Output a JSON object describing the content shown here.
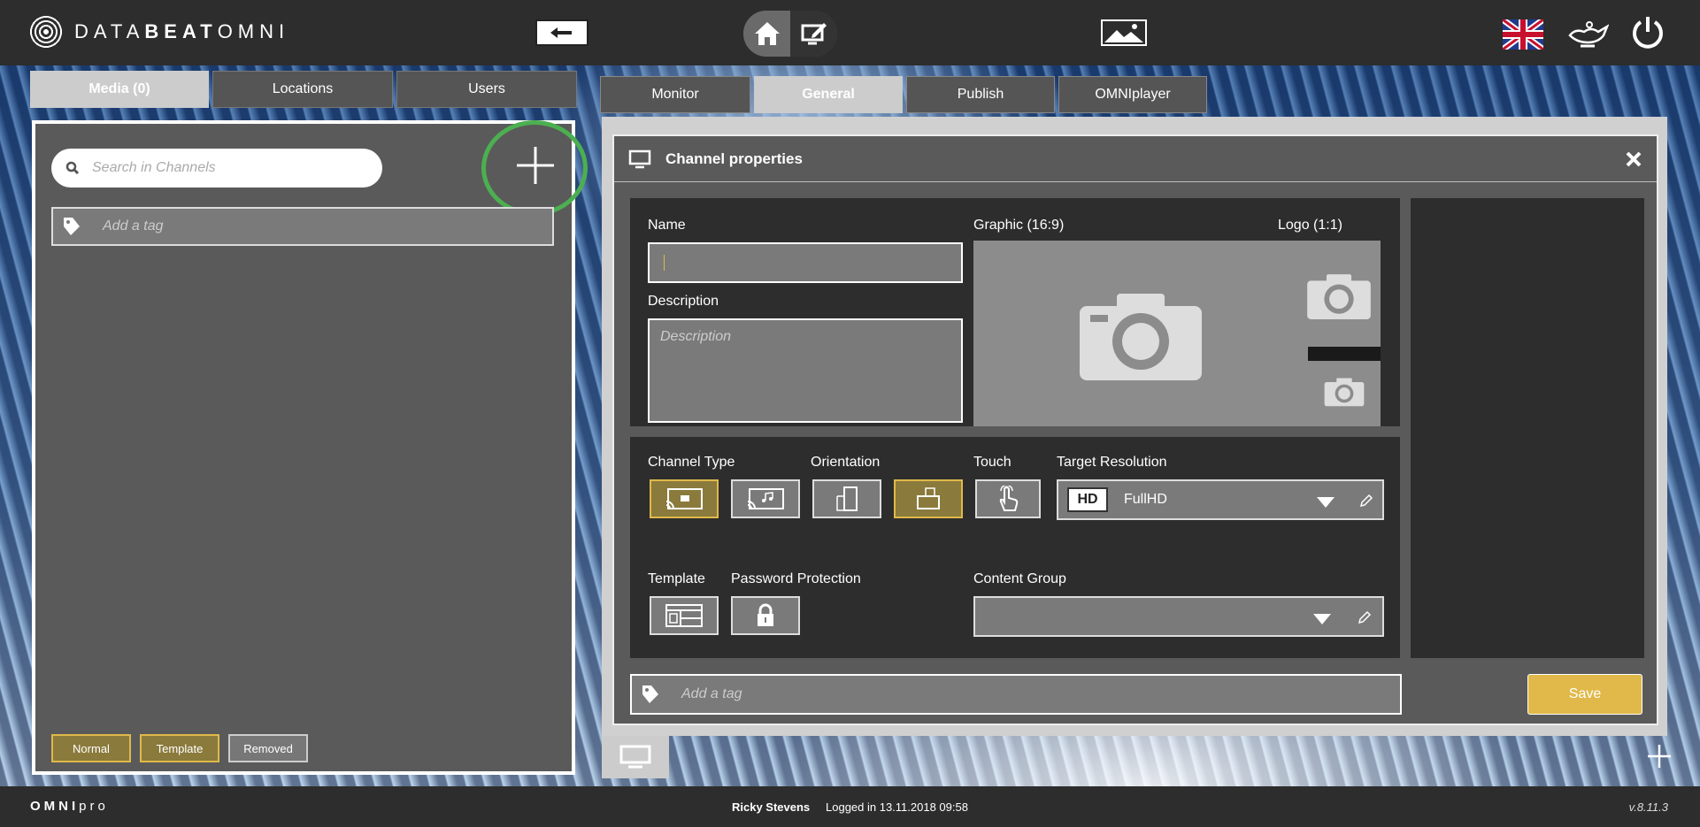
{
  "app": {
    "logo_text_a": "DATA",
    "logo_text_b": "BEAT",
    "logo_text_c": "OMNI"
  },
  "left_tabs": [
    {
      "label": "Media (0)"
    },
    {
      "label": "Locations"
    },
    {
      "label": "Users"
    }
  ],
  "channels": {
    "search_placeholder": "Search in Channels",
    "tag_placeholder": "Add a tag",
    "filters": [
      {
        "label": "Normal",
        "selected": true
      },
      {
        "label": "Template",
        "selected": true
      },
      {
        "label": "Removed",
        "selected": false
      }
    ]
  },
  "right_tabs": [
    {
      "label": "Monitor"
    },
    {
      "label": "General"
    },
    {
      "label": "Publish"
    },
    {
      "label": "OMNIplayer"
    }
  ],
  "dialog": {
    "title": "Channel properties",
    "name_label": "Name",
    "name_value": "",
    "description_label": "Description",
    "description_placeholder": "Description",
    "graphic_label": "Graphic (16:9)",
    "logo_label": "Logo (1:1)",
    "channel_type_label": "Channel Type",
    "orientation_label": "Orientation",
    "touch_label": "Touch",
    "target_resolution_label": "Target Resolution",
    "target_resolution_value": "FullHD",
    "hd_badge": "HD",
    "template_label": "Template",
    "password_label": "Password Protection",
    "content_group_label": "Content Group",
    "content_group_value": "",
    "tag_placeholder": "Add a tag",
    "save_label": "Save"
  },
  "status": {
    "brand_a": "OMNI",
    "brand_b": "pro",
    "user": "Ricky Stevens",
    "login": "Logged in 13.11.2018 09:58",
    "version": "v.8.11.3"
  },
  "colors": {
    "accent": "#e0b94a",
    "highlight_circle": "#4caf50",
    "bar": "#2d2d2d"
  }
}
